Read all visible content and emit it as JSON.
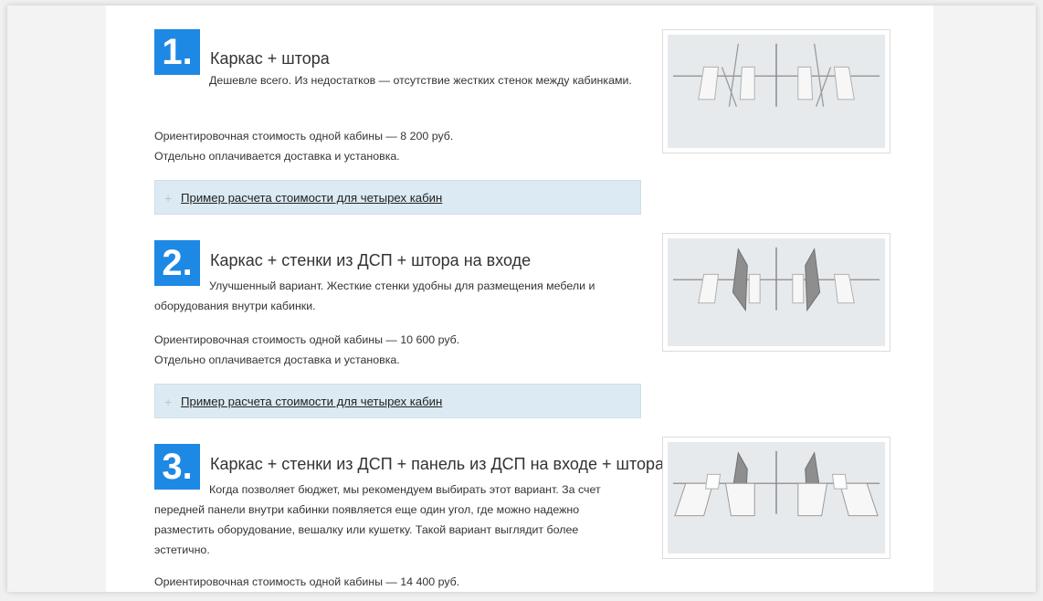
{
  "options": [
    {
      "number": "1",
      "dot": ".",
      "title": "Каркас + штора",
      "description": "Дешевле всего. Из недостатков — отсутствие жестких стенок между кабинками.",
      "price": "Ориентировочная стоимость одной кабины — 8 200 руб.",
      "delivery": "Отдельно оплачивается доставка и установка.",
      "accordion_label": "Пример расчета стоимости для четырех кабин",
      "image_icon": "cabin-frame-curtain-image"
    },
    {
      "number": "2",
      "dot": ".",
      "title": "Каркас + стенки из ДСП + штора на входе",
      "description": "Улучшенный вариант. Жесткие стенки удобны для размещения мебели и оборудования внутри кабинки.",
      "price": "Ориентировочная стоимость одной кабины — 10 600 руб.",
      "delivery": "Отдельно оплачивается доставка и установка.",
      "accordion_label": "Пример расчета стоимости для четырех кабин",
      "image_icon": "cabin-walls-curtain-image"
    },
    {
      "number": "3",
      "dot": ".",
      "title": "Каркас + стенки из ДСП + панель из ДСП на входе + штора",
      "description": "Когда позволяет бюджет, мы рекомендуем выбирать этот вариант. За счет передней панели внутри кабинки появляется еще один угол, где можно надежно разместить оборудование, вешалку или кушетку. Такой вариант выглядит более эстетично.",
      "price": "Ориентировочная стоимость одной кабины — 14 400 руб.",
      "image_icon": "cabin-walls-panel-curtain-image"
    }
  ],
  "accordion_icon": "plus-icon",
  "colors": {
    "accent": "#1e88e5",
    "accordion_bg": "#dbeaf3",
    "page_bg": "#f3f3f3"
  }
}
